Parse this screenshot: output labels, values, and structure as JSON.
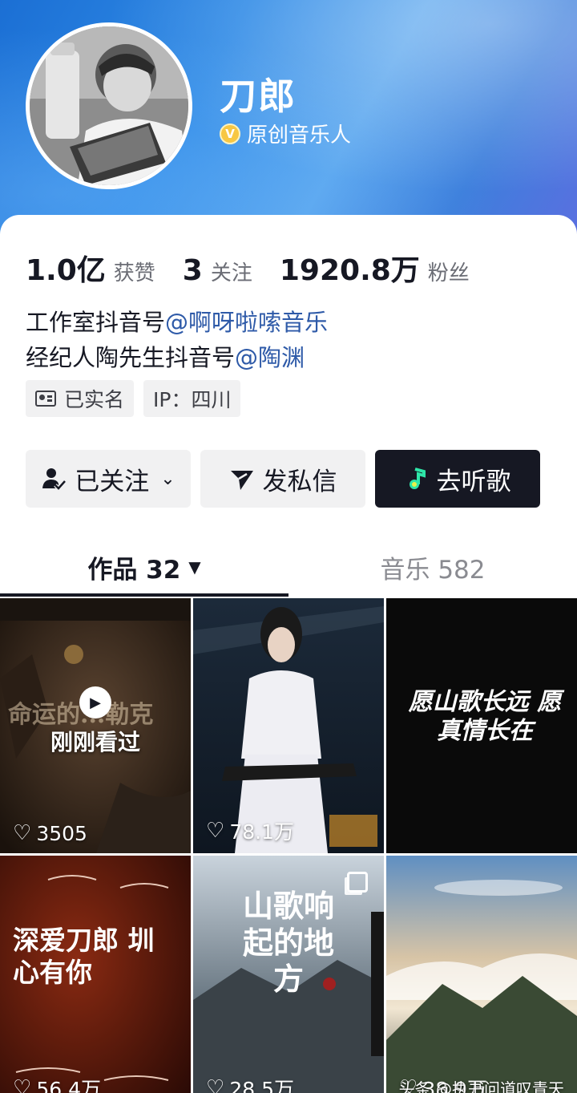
{
  "profile": {
    "name": "刀郎",
    "verify_badge": "V",
    "verify_label": "原创音乐人"
  },
  "stats": [
    {
      "value": "1.0亿",
      "label": "获赞"
    },
    {
      "value": "3",
      "label": "关注"
    },
    {
      "value": "1920.8万",
      "label": "粉丝"
    }
  ],
  "bio": {
    "line1_prefix": "工作室抖音号",
    "line1_mention": "@啊呀啦嗦音乐",
    "line2_prefix": "经纪人陶先生抖音号",
    "line2_mention": "@陶渊"
  },
  "tags": {
    "realname": "已实名",
    "ip": "IP：四川"
  },
  "actions": {
    "follow": "已关注",
    "message": "发私信",
    "listen": "去听歌"
  },
  "tabs": {
    "works": "作品 32",
    "music": "音乐 582"
  },
  "grid": {
    "recent_label": "刚刚看过",
    "items": [
      {
        "likes": "3505",
        "image_text": "命运的...勒克"
      },
      {
        "likes": "78.1万",
        "image_text": ""
      },
      {
        "likes": "",
        "image_text": "愿山歌长远 愿真情长在"
      },
      {
        "likes": "56.4万",
        "image_text": "深爱刀郎 圳心有你"
      },
      {
        "likes": "28.5万",
        "image_text": "山歌响起的地方"
      },
      {
        "likes": "38.9万",
        "image_text": ""
      }
    ]
  },
  "watermark": "头条 @执书问道叹青天",
  "colors": {
    "header_blue": "#2f8ae6",
    "mention": "#2e5aa8",
    "dark_button": "#161823",
    "verify_gold": "#f7c744"
  }
}
